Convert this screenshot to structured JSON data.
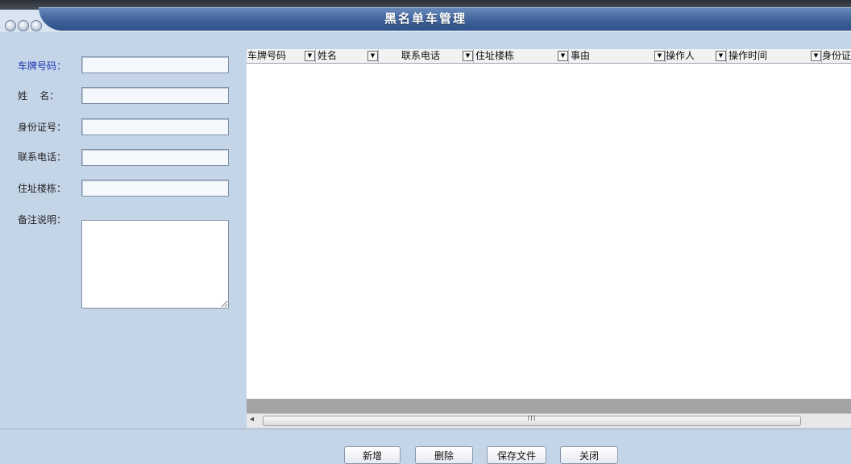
{
  "window": {
    "title": "黑名单车管理"
  },
  "form": {
    "fields": [
      {
        "label": "车牌号码：",
        "value": ""
      },
      {
        "label": "姓    名：",
        "value": ""
      },
      {
        "label": "身份证号：",
        "value": ""
      },
      {
        "label": "联系电话：",
        "value": ""
      },
      {
        "label": "住址楼栋：",
        "value": ""
      }
    ],
    "memo_label": "备注说明：",
    "memo_value": ""
  },
  "grid": {
    "columns": [
      "车牌号码",
      "姓名",
      "联系电话",
      "住址楼栋",
      "事由",
      "操作人",
      "操作时间",
      "身份证"
    ],
    "dropdown_glyph": "▼",
    "rows": []
  },
  "scrollbar": {
    "left_arrow": "◂",
    "grip": "III"
  },
  "buttons": {
    "add": "新增",
    "delete": "删除",
    "save_file": "保存文件",
    "close": "关闭"
  },
  "colors": {
    "titlebar": "#3e6299",
    "panel": "#c5d5e8",
    "active_label": "#2033b4"
  }
}
